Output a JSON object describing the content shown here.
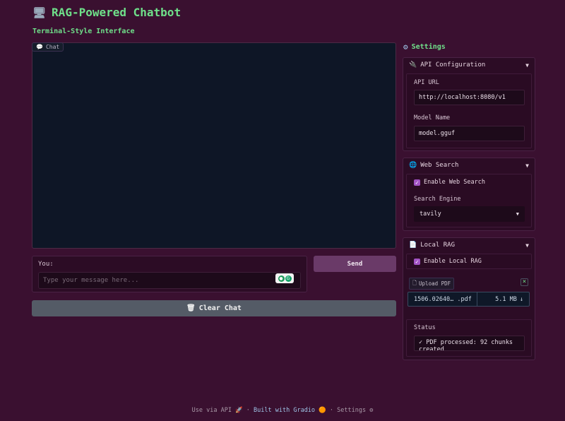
{
  "header": {
    "title": "RAG-Powered Chatbot",
    "subtitle": "Terminal-Style Interface"
  },
  "chat": {
    "tag_label": "Chat"
  },
  "input": {
    "label": "You:",
    "placeholder": "Type your message here..."
  },
  "buttons": {
    "send": "Send",
    "clear": "Clear Chat"
  },
  "settings": {
    "title": "Settings",
    "api": {
      "header": "API Configuration",
      "url_label": "API URL",
      "url_value": "http://localhost:8080/v1",
      "model_label": "Model Name",
      "model_value": "model.gguf"
    },
    "web": {
      "header": "Web Search",
      "enable_label": "Enable Web Search",
      "engine_label": "Search Engine",
      "engine_value": "tavily"
    },
    "rag": {
      "header": "Local RAG",
      "enable_label": "Enable Local RAG",
      "upload_label": "Upload PDF",
      "file_name": "1506.02640… .pdf",
      "file_size": "5.1 MB",
      "status_label": "Status",
      "status_value": "✓ PDF processed: 92 chunks created"
    }
  },
  "footer": {
    "api_text": "Use via API",
    "built_text": "Built with Gradio",
    "settings_text": "Settings",
    "sep": "·"
  }
}
